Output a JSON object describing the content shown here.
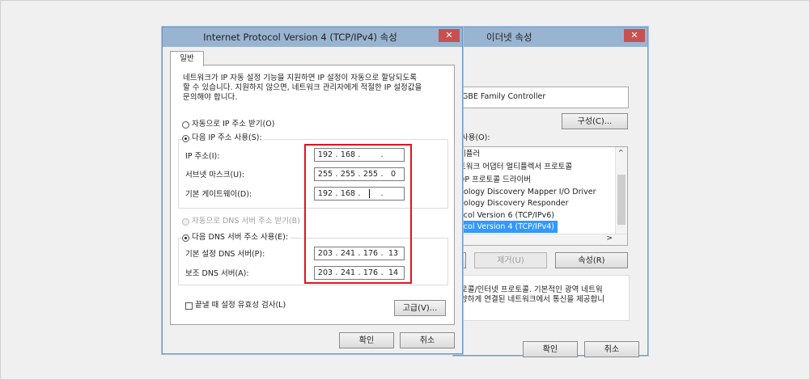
{
  "back_window": {
    "title": "이더넷 속성",
    "adapter_name": "GBE Family Controller",
    "configure_button": "구성(C)...",
    "uses_label": "사용(O):",
    "items": [
      {
        "label": "케플러"
      },
      {
        "label": "트워크 어댑터 멀티플렉서 프로토콜"
      },
      {
        "label": "DP 프로토콜 드라이버"
      },
      {
        "label": "pology Discovery Mapper I/O Driver"
      },
      {
        "label": "pology Discovery Responder"
      },
      {
        "label": "ocol Version 6 (TCP/IPv6)"
      },
      {
        "label": "ocol Version 4 (TCP/IPv4)",
        "selected": true
      }
    ],
    "remove_button": "제거(U)",
    "properties_button": "속성(R)",
    "description_line1": "로콜/인터넷 프로토콜. 기본적인 광역 네트워",
    "description_line2": "양하게 연결된 네트워크에서 통신을 제공합니",
    "ok_button": "확인",
    "cancel_button": "취소"
  },
  "front_window": {
    "title": "Internet Protocol Version 4 (TCP/IPv4) 속성",
    "tab_general": "일반",
    "description_line1": "네트워크가 IP 자동 설정 기능을 지원하면 IP 설정이 자동으로 할당되도록",
    "description_line2": "할 수 있습니다. 지원하지 않으면, 네트워크 관리자에게 적절한 IP 설정값을",
    "description_line3": "문의해야 합니다.",
    "auto_ip_label": "자동으로 IP 주소 받기(O)",
    "manual_ip_label": "다음 IP 주소 사용(S):",
    "ip_address_label": "IP 주소(I):",
    "ip_address": [
      "192",
      "168",
      "",
      ""
    ],
    "subnet_label": "서브넷 마스크(U):",
    "subnet": [
      "255",
      "255",
      "255",
      "0"
    ],
    "gateway_label": "기본 게이트웨이(D):",
    "gateway": [
      "192",
      "168",
      "",
      ""
    ],
    "auto_dns_label": "자동으로 DNS 서버 주소 받기(B)",
    "manual_dns_label": "다음 DNS 서버 주소 사용(E):",
    "preferred_dns_label": "기본 설정 DNS 서버(P):",
    "preferred_dns": [
      "203",
      "241",
      "176",
      "13"
    ],
    "alternate_dns_label": "보조 DNS 서버(A):",
    "alternate_dns": [
      "203",
      "241",
      "176",
      "14"
    ],
    "validate_label": "끝낼 때 설정 유효성 검사(L)",
    "advanced_button": "고급(V)...",
    "ok_button": "확인",
    "cancel_button": "취소"
  },
  "colors": {
    "title_bar": "#99b4d1",
    "close_button": "#c75050",
    "highlight_box": "#e0131f",
    "selection": "#3399ff"
  }
}
